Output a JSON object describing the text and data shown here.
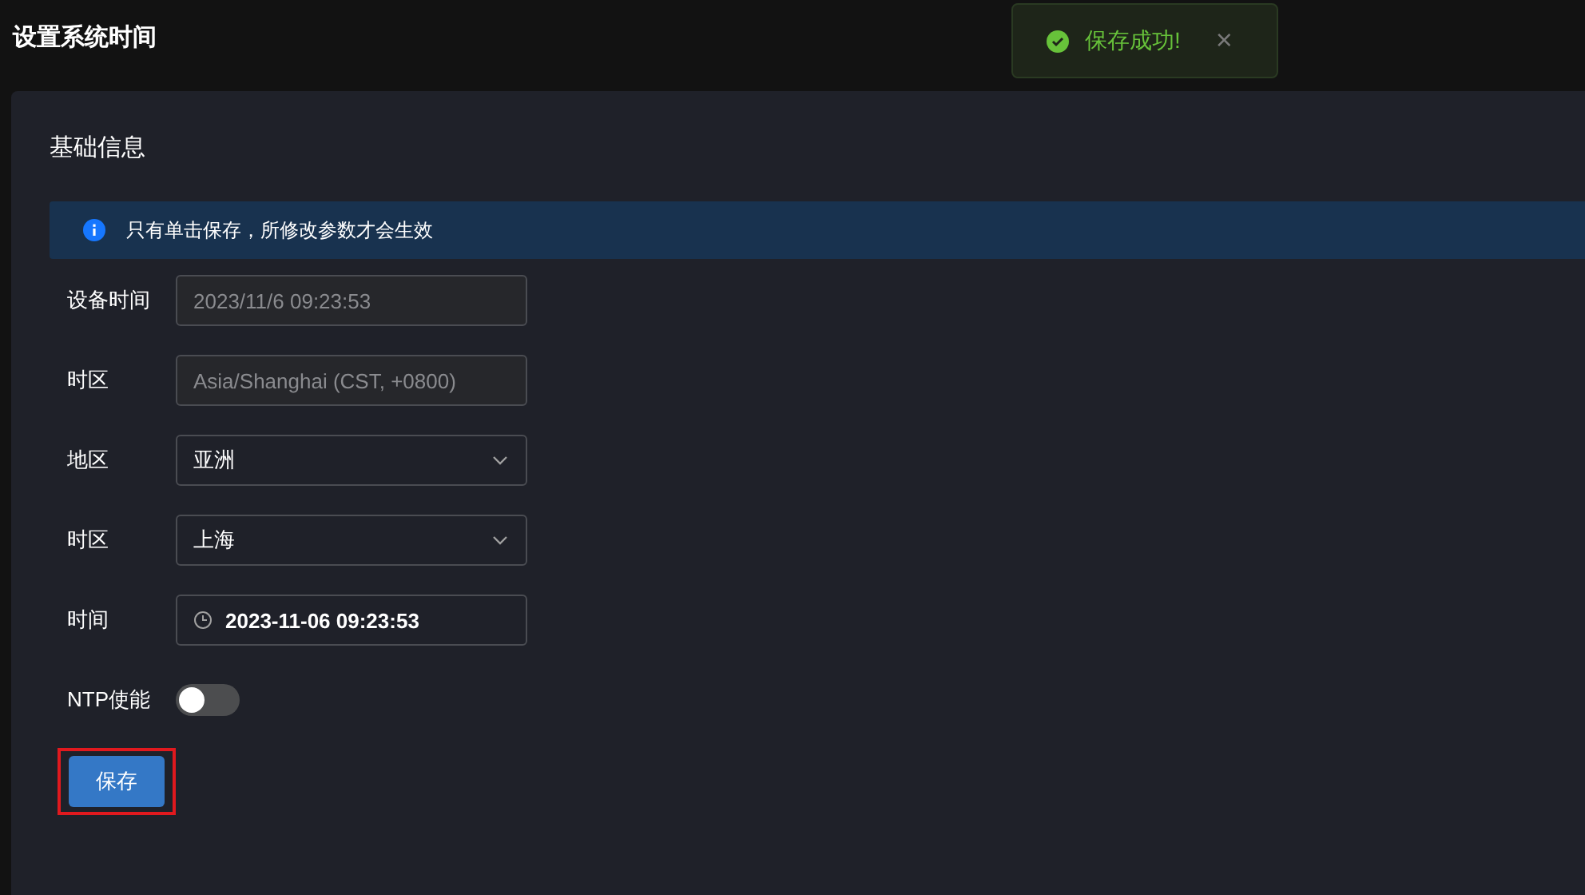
{
  "page_title": "设置系统时间",
  "toast": {
    "kind": "success",
    "message": "保存成功!",
    "close": "×"
  },
  "section": {
    "title": "基础信息"
  },
  "alert": {
    "kind": "info",
    "text": "只有单击保存，所修改参数才会生效"
  },
  "fields": [
    {
      "kind": "readonly",
      "label": "设备时间",
      "value": "2023/11/6 09:23:53"
    },
    {
      "kind": "readonly",
      "label": "时区",
      "value": "Asia/Shanghai (CST, +0800)"
    },
    {
      "kind": "select",
      "label": "地区",
      "value": "亚洲"
    },
    {
      "kind": "select",
      "label": "时区",
      "value": "上海"
    },
    {
      "kind": "time",
      "label": "时间",
      "value": "2023-11-06 09:23:53"
    },
    {
      "kind": "switch",
      "label": "NTP使能",
      "on": false
    }
  ],
  "save_button": {
    "label": "保存",
    "highlighted": true
  }
}
